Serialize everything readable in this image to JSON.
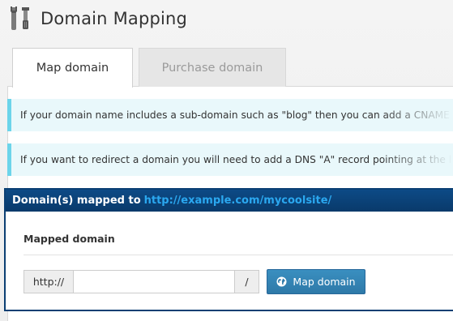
{
  "header": {
    "title": "Domain Mapping",
    "icon": "tools-icon"
  },
  "tabs": [
    {
      "label": "Map domain",
      "active": true
    },
    {
      "label": "Purchase domain",
      "active": false
    }
  ],
  "notices": [
    {
      "text": "If your domain name includes a sub-domain such as \"blog\" then you can add a CNAME"
    },
    {
      "text": "If you want to redirect a domain you will need to add a DNS \"A\" record pointing at the l"
    }
  ],
  "panel": {
    "title_prefix": "Domain(s) mapped to",
    "title_link": "http://example.com/mycoolsite/",
    "section_label": "Mapped domain",
    "input": {
      "prefix": "http://",
      "value": "",
      "placeholder": "",
      "suffix": "/"
    },
    "button_label": "Map domain",
    "button_icon": "globe-icon"
  },
  "colors": {
    "notice_bg": "#e9f8fb",
    "notice_border": "#6cd4ea",
    "panel_header": "#0b3f73",
    "link": "#2ba8f0",
    "button": "#337fb0"
  }
}
